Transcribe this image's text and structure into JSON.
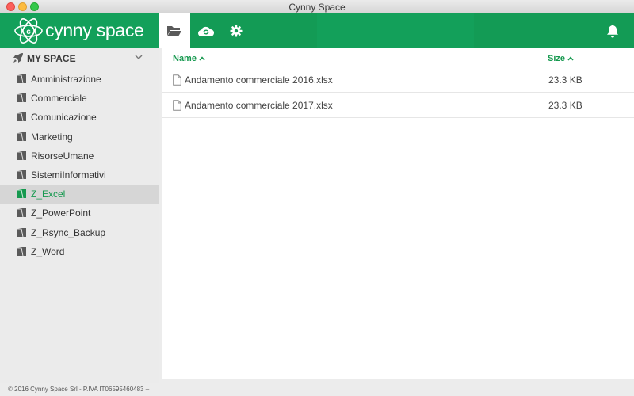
{
  "window": {
    "title": "Cynny Space"
  },
  "header": {
    "logo_text": "cynny space",
    "tabs": [
      {
        "icon": "folder-open-icon"
      },
      {
        "icon": "cloud-sync-icon"
      },
      {
        "icon": "gear-icon"
      }
    ],
    "notification_icon": "bell-icon",
    "accent_color": "#139b55"
  },
  "sidebar": {
    "space_label": "MY SPACE",
    "items": [
      {
        "label": "Amministrazione"
      },
      {
        "label": "Commerciale"
      },
      {
        "label": "Comunicazione"
      },
      {
        "label": "Marketing"
      },
      {
        "label": "RisorseUmane"
      },
      {
        "label": "SistemiInformativi"
      },
      {
        "label": "Z_Excel"
      },
      {
        "label": "Z_PowerPoint"
      },
      {
        "label": "Z_Rsync_Backup"
      },
      {
        "label": "Z_Word"
      }
    ],
    "selected_label": "Z_Excel"
  },
  "table": {
    "columns": {
      "name": "Name",
      "size": "Size"
    },
    "rows": [
      {
        "name": "Andamento commerciale 2016.xlsx",
        "size": "23.3 KB"
      },
      {
        "name": "Andamento commerciale 2017.xlsx",
        "size": "23.3 KB"
      }
    ]
  },
  "footer": {
    "text": "© 2016 Cynny Space Srl - P.IVA IT06595460483 –"
  }
}
